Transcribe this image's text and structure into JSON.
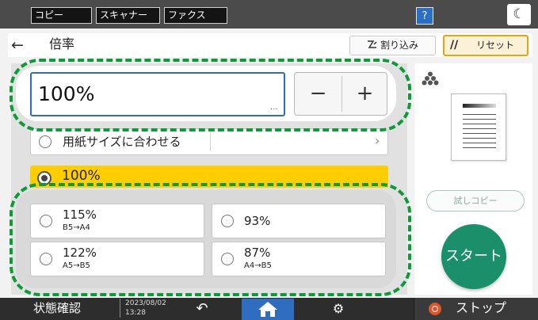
{
  "topbar": {
    "tabs": [
      {
        "label": "コピー"
      },
      {
        "label": "スキャナー"
      },
      {
        "label": "ファクス"
      }
    ],
    "help_label": "?",
    "moon_glyph": "☾"
  },
  "header": {
    "back_glyph": "←",
    "title": "倍率",
    "interrupt_label": "割り込み",
    "reset_label": "リセット",
    "reset_icon_glyph": "//"
  },
  "ratio": {
    "value": "100%",
    "dots": "...",
    "minus_label": "−",
    "plus_label": "+"
  },
  "fit_to_paper": {
    "label": "用紙サイズに合わせる",
    "chevron": "›"
  },
  "selected_option": {
    "label": "100%"
  },
  "presets": [
    {
      "percent": "115%",
      "sub": "B5→A4"
    },
    {
      "percent": "93%",
      "sub": ""
    },
    {
      "percent": "122%",
      "sub": "A5→B5"
    },
    {
      "percent": "87%",
      "sub": "A4→B5"
    }
  ],
  "right_panel": {
    "trial_copy_label": "試しコピー",
    "start_label": "スタート"
  },
  "bottombar": {
    "status_check_label": "状態確認",
    "date": "2023/08/02",
    "time": "13:28",
    "undo_glyph": "↶",
    "settings_glyph": "⚙",
    "stop_label": "ストップ"
  },
  "colors": {
    "accent_blue": "#2f6dc0",
    "selected_yellow": "#ffce00",
    "start_green": "#1a8f6a",
    "highlight_dash_green": "#0f9a3a",
    "stop_orange": "#e2542a"
  }
}
